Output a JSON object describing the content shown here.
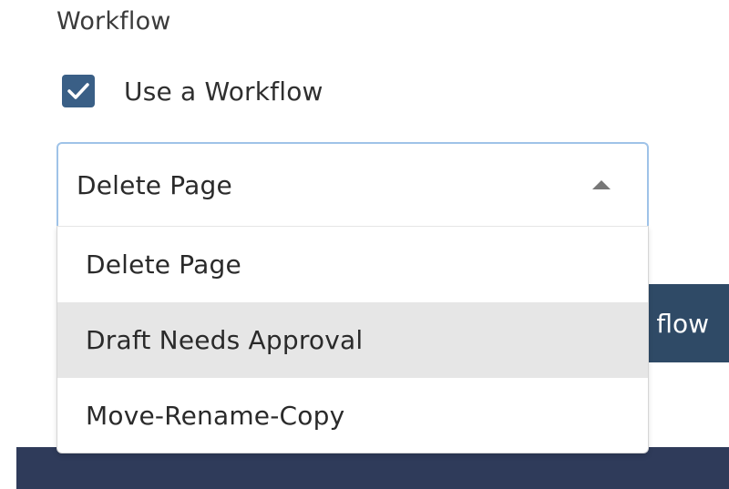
{
  "section": {
    "heading": "Workflow"
  },
  "use_workflow": {
    "label": "Use a Workflow",
    "checked": true,
    "color": "#3a5f86"
  },
  "workflow_select": {
    "selected_value": "Delete Page",
    "expanded": true,
    "focus_border_color": "#9fc3e8",
    "options": [
      {
        "label": "Delete Page",
        "highlighted": false
      },
      {
        "label": "Draft Needs Approval",
        "highlighted": true
      },
      {
        "label": "Move-Rename-Copy",
        "highlighted": false
      }
    ]
  },
  "background_button": {
    "visible_label": "flow",
    "color": "#2f4a66"
  },
  "footer_bar": {
    "color": "#2f3b5a"
  },
  "icons": {
    "checkbox": "checkmark-icon",
    "select_caret": "caret-up-icon"
  }
}
